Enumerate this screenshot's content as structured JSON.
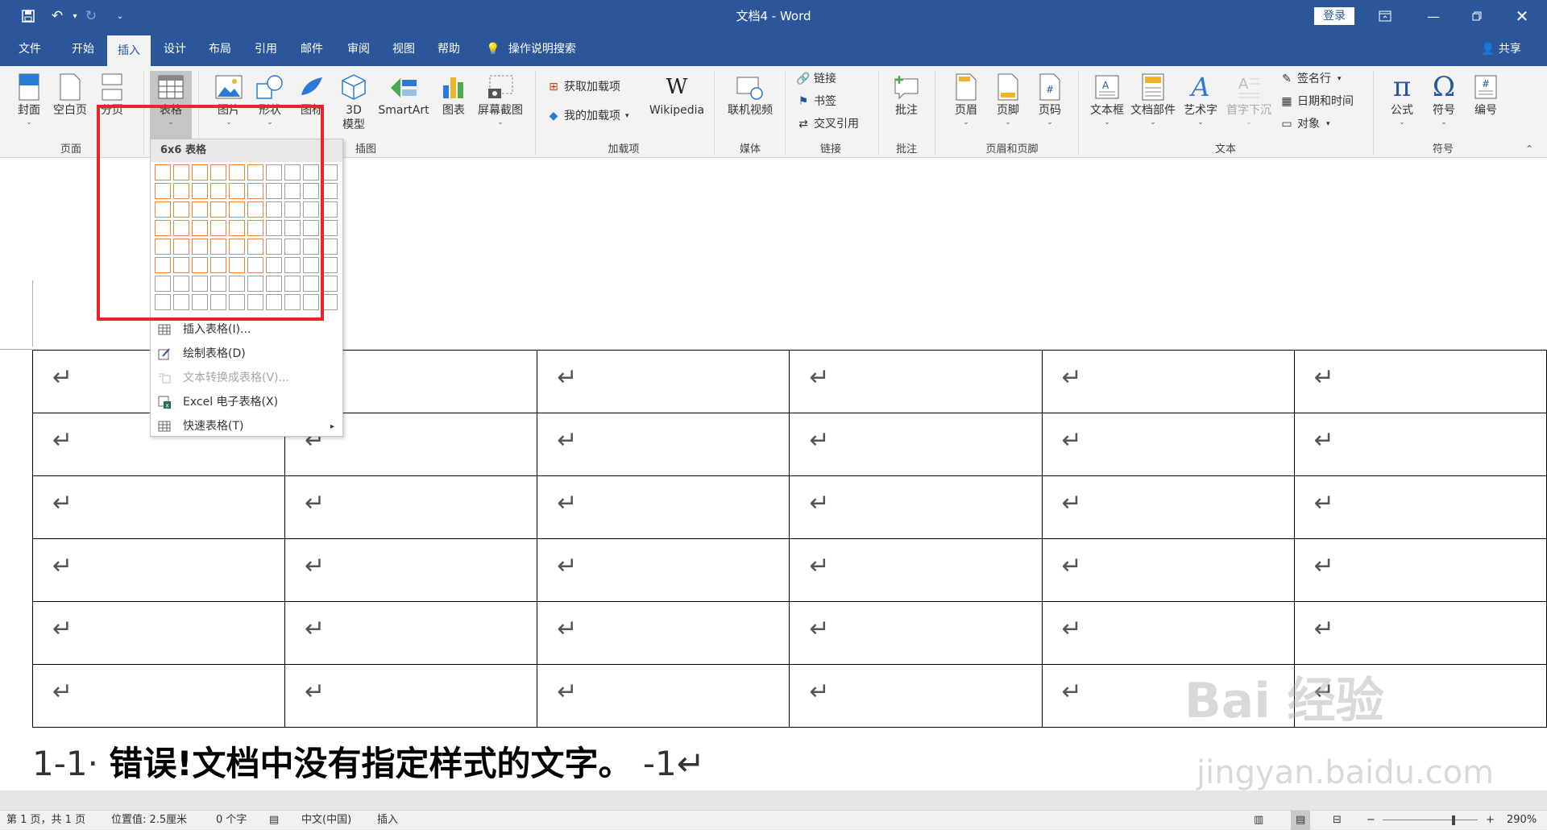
{
  "window": {
    "title": "文档4 - Word",
    "login_label": "登录"
  },
  "tabs": [
    "文件",
    "开始",
    "插入",
    "设计",
    "布局",
    "引用",
    "邮件",
    "审阅",
    "视图",
    "帮助"
  ],
  "active_tab": "插入",
  "tell_me": "操作说明搜索",
  "share": "共享",
  "ribbon": {
    "pages": {
      "group": "页面",
      "cover": "封面",
      "blank": "空白页",
      "break": "分页"
    },
    "tables": {
      "table": "表格"
    },
    "illustrations": {
      "group": "插图",
      "picture": "图片",
      "shapes": "形状",
      "icons": "图标",
      "model3d": "3D\n模型",
      "smartart": "SmartArt",
      "chart": "图表",
      "screenshot": "屏幕截图"
    },
    "addins": {
      "group": "加载项",
      "get": "获取加载项",
      "my": "我的加载项",
      "wikipedia": "Wikipedia"
    },
    "media": {
      "group": "媒体",
      "video": "联机视频"
    },
    "links": {
      "group": "链接",
      "link": "链接",
      "bookmark": "书签",
      "crossref": "交叉引用"
    },
    "comments": {
      "group": "批注",
      "comment": "批注"
    },
    "headerfooter": {
      "group": "页眉和页脚",
      "header": "页眉",
      "footer": "页脚",
      "pagenum": "页码"
    },
    "text": {
      "group": "文本",
      "textbox": "文本框",
      "quickparts": "文档部件",
      "wordart": "艺术字",
      "dropcap": "首字下沉",
      "signature": "签名行",
      "datetime": "日期和时间",
      "object": "对象"
    },
    "symbols": {
      "group": "符号",
      "equation": "公式",
      "symbol": "符号",
      "number": "编号"
    }
  },
  "dropdown": {
    "header": "6x6 表格",
    "grid_cols": 10,
    "grid_rows": 8,
    "selected_cols": 6,
    "selected_rows": 6,
    "items": [
      {
        "label": "插入表格(I)...",
        "enabled": true
      },
      {
        "label": "绘制表格(D)",
        "enabled": true
      },
      {
        "label": "文本转换成表格(V)...",
        "enabled": false
      },
      {
        "label": "Excel 电子表格(X)",
        "enabled": true
      },
      {
        "label": "快速表格(T)",
        "enabled": true,
        "submenu": true
      }
    ]
  },
  "document": {
    "table_rows": 6,
    "table_cols": 6,
    "cell_mark": "↵",
    "caption_num": "1-1·",
    "caption_text": "错误!文档中没有指定样式的文字。",
    "caption_tail": "-1↵"
  },
  "watermark": {
    "brand": "Bai 经验",
    "url": "jingyan.baidu.com"
  },
  "status": {
    "page": "第 1 页，共 1 页",
    "position": "位置值: 2.5厘米",
    "words": "0 个字",
    "language": "中文(中国)",
    "mode": "插入",
    "zoom": "290%"
  },
  "colors": {
    "accent": "#2b579a",
    "highlight": "#e8853e",
    "annotation": "#e8252b"
  }
}
